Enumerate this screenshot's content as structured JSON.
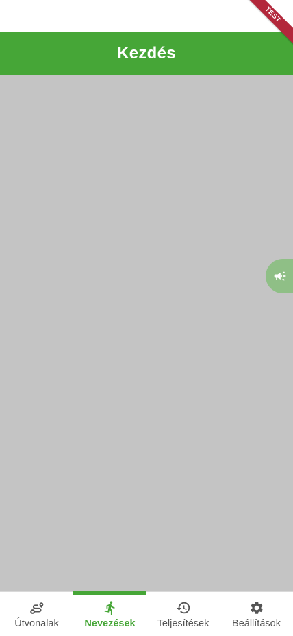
{
  "app_bar": {
    "title": "Kezdés"
  },
  "banner": {
    "label": "TEST",
    "color": "#b3273b"
  },
  "colors": {
    "brand_green": "#46a637",
    "content_bg": "#c4c4c4",
    "fab_bg": "#8fbf86",
    "nav_inactive": "#555555"
  },
  "fab": {
    "icon": "megaphone-icon"
  },
  "bottom_nav": {
    "active_index": 1,
    "items": [
      {
        "label": "Útvonalak",
        "icon": "route-icon"
      },
      {
        "label": "Nevezések",
        "icon": "running-icon"
      },
      {
        "label": "Teljesítések",
        "icon": "history-icon"
      },
      {
        "label": "Beállítások",
        "icon": "gear-icon"
      }
    ]
  }
}
